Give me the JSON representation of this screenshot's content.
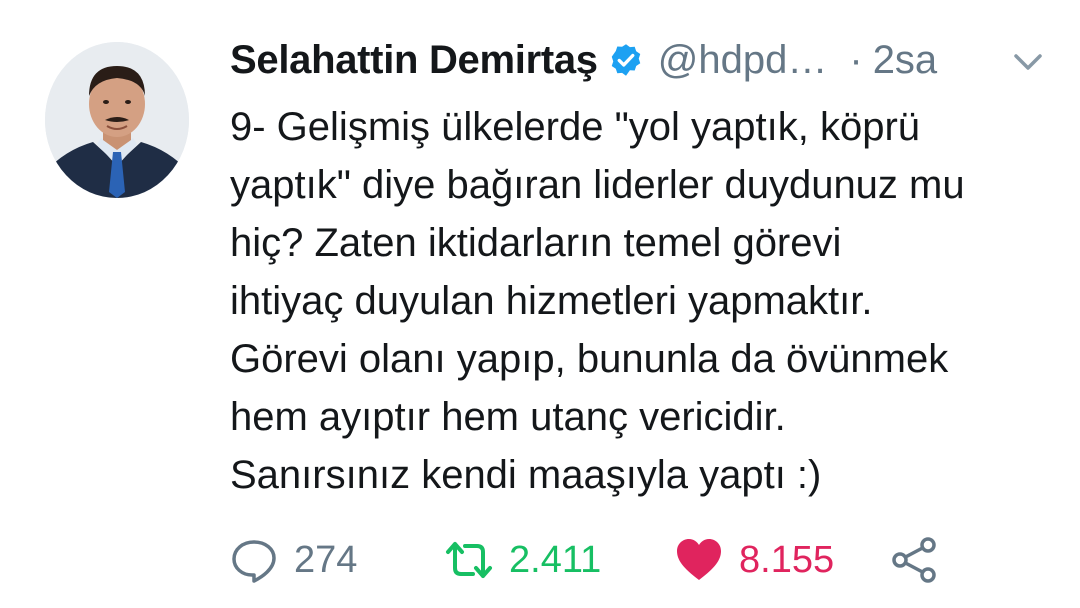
{
  "tweet": {
    "author": {
      "display_name": "Selahattin Demirtaş",
      "handle": "@hdpd…",
      "verified": true,
      "avatar_icon": "profile-photo"
    },
    "separator": "·",
    "time": "2sa",
    "text": "9- Gelişmiş ülkelerde \"yol yaptık, köprü\nyaptık\" diye bağıran liderler duydunuz mu\nhiç? Zaten iktidarların temel görevi\nihtiyaç duyulan hizmetleri yapmaktır.\nGörevi olanı yapıp, bununla da övünmek\nhem ayıptır hem utanç vericidir.\nSanırsınız kendi maaşıyla yaptı :)",
    "actions": {
      "reply": {
        "icon": "reply-icon",
        "count": "274"
      },
      "retweet": {
        "icon": "retweet-icon",
        "count": "2.411",
        "color": "#17bf63"
      },
      "like": {
        "icon": "heart-icon",
        "count": "8.155",
        "color": "#e0245e",
        "liked": true
      },
      "share": {
        "icon": "share-icon"
      }
    }
  },
  "colors": {
    "text": "#14171a",
    "secondary": "#657786",
    "verified": "#1da1f2"
  }
}
